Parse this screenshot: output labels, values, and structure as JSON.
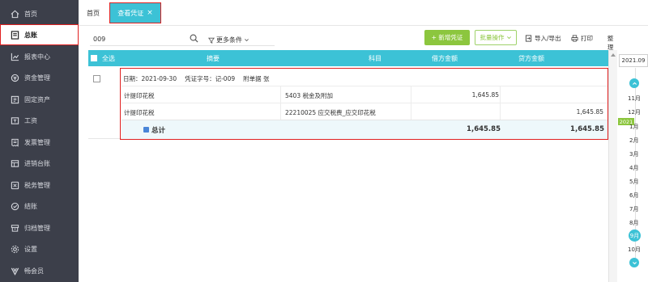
{
  "sidebar": {
    "items": [
      {
        "label": "首页",
        "icon": "home-icon"
      },
      {
        "label": "总账",
        "icon": "ledger-icon",
        "active": true
      },
      {
        "label": "报表中心",
        "icon": "report-icon"
      },
      {
        "label": "资金管理",
        "icon": "money-icon"
      },
      {
        "label": "固定资产",
        "icon": "asset-icon"
      },
      {
        "label": "工资",
        "icon": "salary-icon"
      },
      {
        "label": "发票管理",
        "icon": "invoice-icon"
      },
      {
        "label": "进销台账",
        "icon": "inventory-icon"
      },
      {
        "label": "税务管理",
        "icon": "tax-icon"
      },
      {
        "label": "结账",
        "icon": "close-books-icon"
      },
      {
        "label": "归档管理",
        "icon": "archive-icon"
      },
      {
        "label": "设置",
        "icon": "gear-icon"
      },
      {
        "label": "畅会员",
        "icon": "vip-icon"
      }
    ]
  },
  "tabs": {
    "home": "首页",
    "active": "查看凭证",
    "close": "×"
  },
  "toolbar": {
    "search_value": "009",
    "filter_label": "更多条件",
    "new_label": "+ 新增凭证",
    "batch_label": "批量操作",
    "import_export_label": "导入/导出",
    "print_label": "打印",
    "renumber_label": "整理断号"
  },
  "table": {
    "headers": {
      "select_all": "全选",
      "summary": "摘要",
      "account": "科目",
      "debit": "借方金额",
      "credit": "贷方金额"
    },
    "voucher": {
      "date": "日期：2021-09-30",
      "number": "凭证字号：记-009",
      "attachments": "附单据 张",
      "rows": [
        {
          "summary": "计提印花税",
          "account": "5403 税金及附加",
          "debit": "1,645.85",
          "credit": ""
        },
        {
          "summary": "计提印花税",
          "account": "22210025 应交税费_应交印花税",
          "debit": "",
          "credit": "1,645.85"
        }
      ],
      "total_label": "总计",
      "total_debit": "1,645.85",
      "total_credit": "1,645.85"
    }
  },
  "period": {
    "selected": "2021.09",
    "year_badge": "2021",
    "months_before": [
      "11月",
      "12月"
    ],
    "months_after": [
      "1月",
      "2月",
      "3月",
      "4月",
      "5月",
      "6月",
      "7月",
      "8月"
    ],
    "active_month": "9月",
    "months_tail": [
      "10月"
    ]
  },
  "colors": {
    "sidebar_bg": "#3c3f4a",
    "accent": "#3cc2d6",
    "green": "#8cc63e",
    "highlight_red": "#e02020"
  }
}
